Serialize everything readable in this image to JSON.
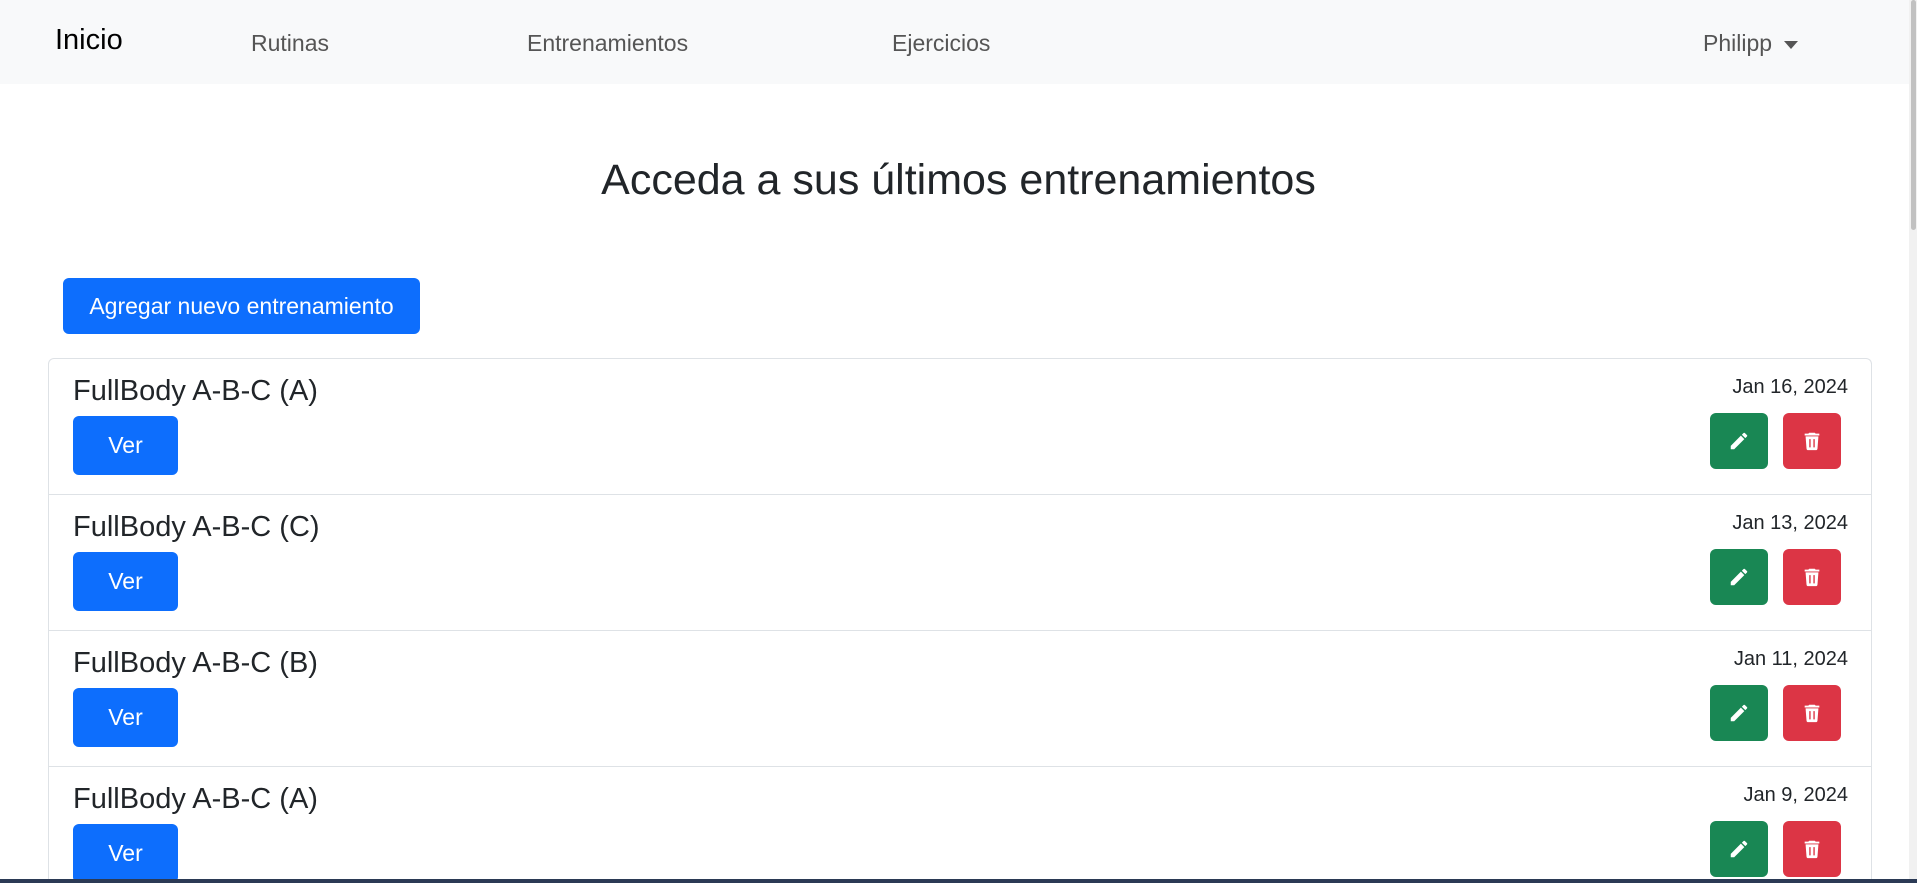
{
  "navbar": {
    "brand": "Inicio",
    "links": [
      "Rutinas",
      "Entrenamientos",
      "Ejercicios"
    ],
    "user": "Philipp"
  },
  "page_title": "Acceda a sus últimos entrenamientos",
  "add_button": "Agregar nuevo entrenamiento",
  "workouts": [
    {
      "title": "FullBody A-B-C (A)",
      "date": "Jan 16, 2024",
      "view_label": "Ver"
    },
    {
      "title": "FullBody A-B-C (C)",
      "date": "Jan 13, 2024",
      "view_label": "Ver"
    },
    {
      "title": "FullBody A-B-C (B)",
      "date": "Jan 11, 2024",
      "view_label": "Ver"
    },
    {
      "title": "FullBody A-B-C (A)",
      "date": "Jan 9, 2024",
      "view_label": "Ver"
    }
  ],
  "icons": {
    "edit": "pencil-icon",
    "delete": "trash-icon",
    "user_menu": "caret-down-icon"
  },
  "colors": {
    "primary": "#0d6efd",
    "success": "#198754",
    "danger": "#dc3545",
    "navbar_bg": "#f8f9fa"
  }
}
